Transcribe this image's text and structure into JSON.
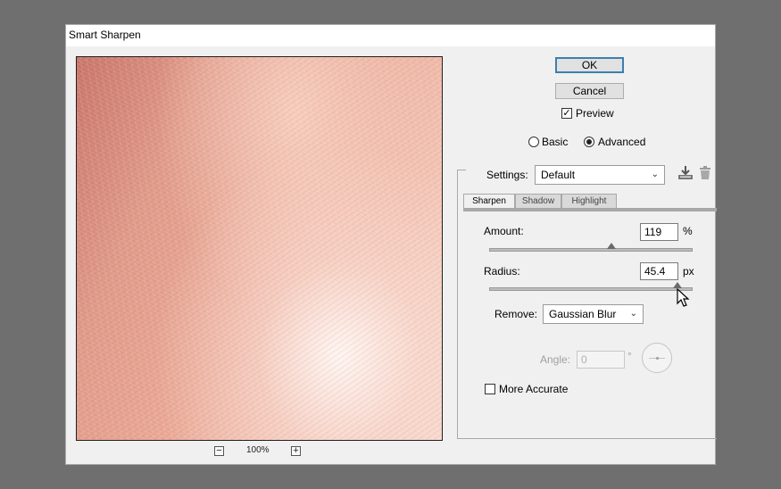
{
  "window": {
    "title": "Smart Sharpen"
  },
  "preview": {
    "zoom_label": "100%",
    "zoom_out": "−",
    "zoom_in": "+"
  },
  "buttons": {
    "ok": "OK",
    "cancel": "Cancel"
  },
  "preview_checkbox": {
    "label": "Preview",
    "checked": true,
    "check_glyph": "✓"
  },
  "mode": {
    "basic_label": "Basic",
    "advanced_label": "Advanced",
    "selected": "Advanced"
  },
  "settings": {
    "label": "Settings:",
    "value": "Default",
    "arrow": "⌄"
  },
  "tabs": [
    {
      "label": "Sharpen",
      "active": true
    },
    {
      "label": "Shadow",
      "active": false
    },
    {
      "label": "Highlight",
      "active": false
    }
  ],
  "amount": {
    "label": "Amount:",
    "value": "119",
    "unit": "%",
    "slider_fraction": 0.6
  },
  "radius": {
    "label": "Radius:",
    "value": "45.4",
    "unit": "px",
    "slider_fraction": 0.93
  },
  "remove": {
    "label": "Remove:",
    "value": "Gaussian Blur",
    "arrow": "⌄"
  },
  "angle": {
    "label": "Angle:",
    "value": "0",
    "unit": "°"
  },
  "more_accurate": {
    "label": "More Accurate",
    "checked": false
  },
  "icons": {
    "save_preset": "download-icon",
    "delete_preset": "trash-icon",
    "cursor": "pointer-cursor-icon"
  }
}
